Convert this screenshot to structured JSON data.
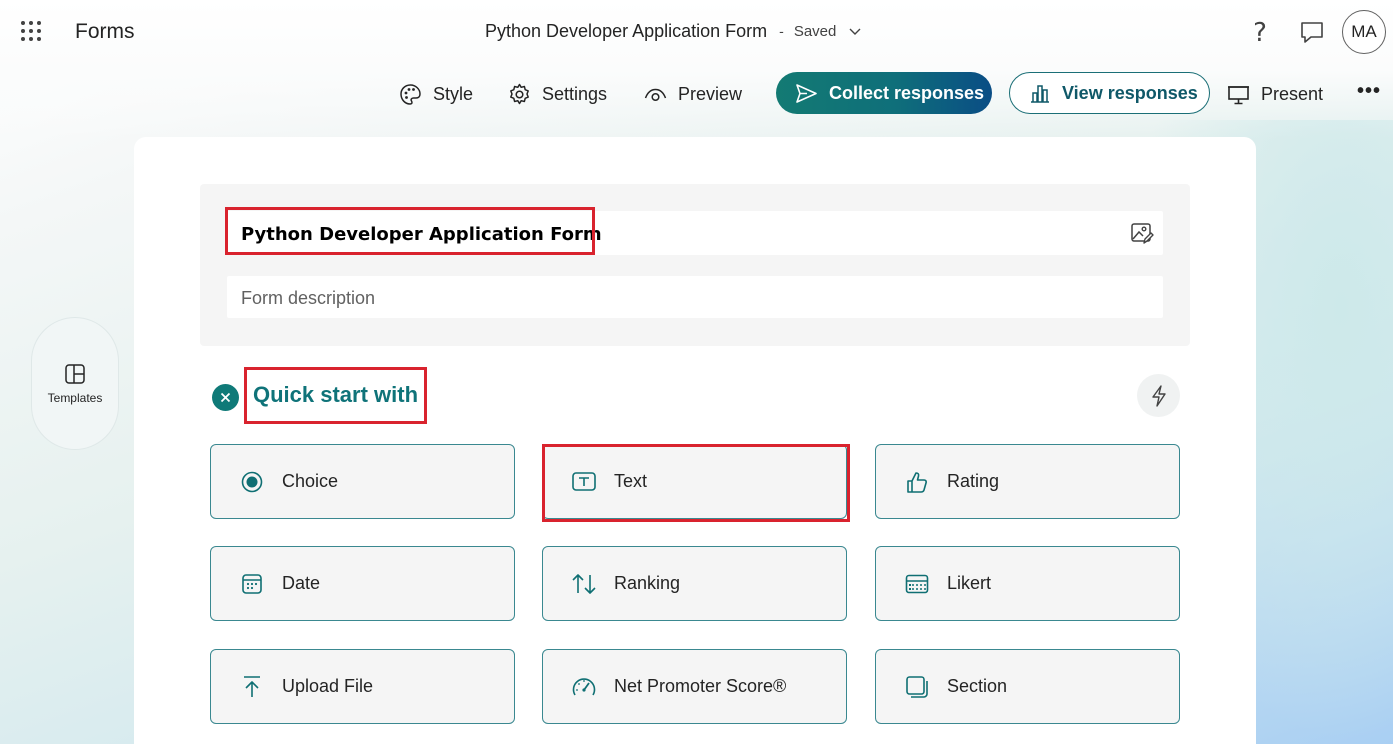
{
  "app": {
    "name": "Forms"
  },
  "document": {
    "title": "Python Developer Application Form",
    "separator": "-",
    "status": "Saved"
  },
  "topbar": {
    "help_glyph": "?",
    "avatar_initials": "MA"
  },
  "commands": {
    "style": "Style",
    "settings": "Settings",
    "preview": "Preview",
    "collect": "Collect responses",
    "view": "View responses",
    "present": "Present",
    "more": "•••"
  },
  "sidebar": {
    "templates_label": "Templates"
  },
  "form": {
    "title": "Python Developer Application Form",
    "description_placeholder": "Form description"
  },
  "quick_start": {
    "label": "Quick start with",
    "close_glyph": "✕",
    "items": [
      {
        "label": "Choice",
        "icon": "radio-icon"
      },
      {
        "label": "Text",
        "icon": "text-icon"
      },
      {
        "label": "Rating",
        "icon": "thumbs-up-icon"
      },
      {
        "label": "Date",
        "icon": "calendar-icon"
      },
      {
        "label": "Ranking",
        "icon": "arrows-sort-icon"
      },
      {
        "label": "Likert",
        "icon": "likert-grid-icon"
      },
      {
        "label": "Upload File",
        "icon": "upload-icon"
      },
      {
        "label": "Net Promoter Score®",
        "icon": "gauge-icon"
      },
      {
        "label": "Section",
        "icon": "section-icon"
      }
    ]
  },
  "colors": {
    "accent": "#0f7a78",
    "highlight": "#d9232e",
    "brand_gradient_end": "#0a4d85"
  }
}
